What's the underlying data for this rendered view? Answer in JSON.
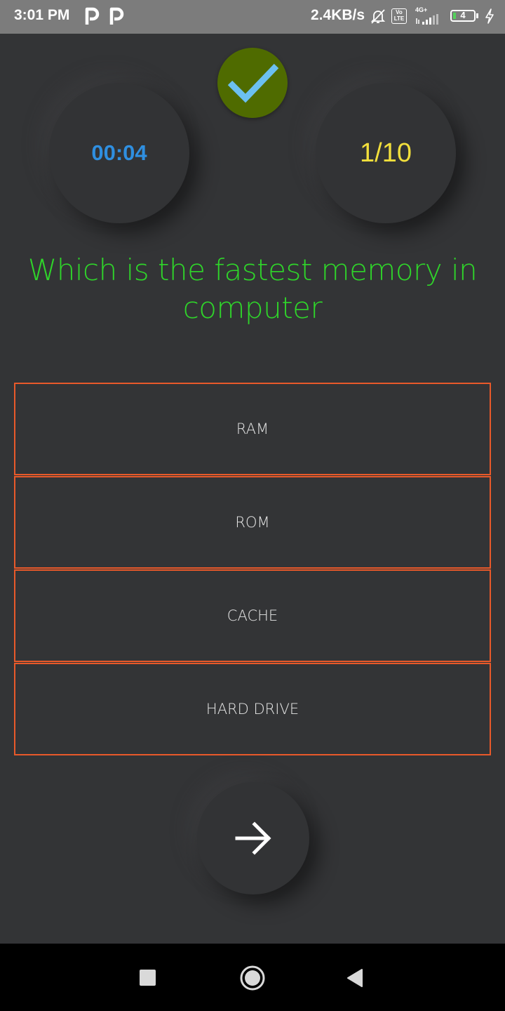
{
  "status_bar": {
    "time": "3:01 PM",
    "network_speed": "2.4KB/s",
    "network_type": "4G+",
    "volte": "Vo LTE",
    "battery_level": "4",
    "icons": [
      "parking-icon",
      "parking-icon",
      "notifications-off-icon",
      "volte-icon",
      "signal-icon",
      "battery-icon",
      "charging-icon"
    ]
  },
  "quiz": {
    "timer": "00:04",
    "progress": "1/10",
    "answered_correct": true,
    "question": "Which is the fastest memory in computer",
    "options": [
      {
        "label": "RAM"
      },
      {
        "label": "ROM"
      },
      {
        "label": "CACHE"
      },
      {
        "label": "HARD DRIVE"
      }
    ],
    "next_icon": "arrow-right-icon"
  },
  "colors": {
    "background": "#333436",
    "timer": "#2f8fe0",
    "progress": "#f2df3c",
    "question": "#2fd52a",
    "option_border": "#e8592a",
    "check_badge": "#4f6b00",
    "check_mark": "#6cc0f0"
  },
  "nav_bar": {
    "icons": [
      "recents-square-icon",
      "home-circle-icon",
      "back-triangle-icon"
    ]
  }
}
